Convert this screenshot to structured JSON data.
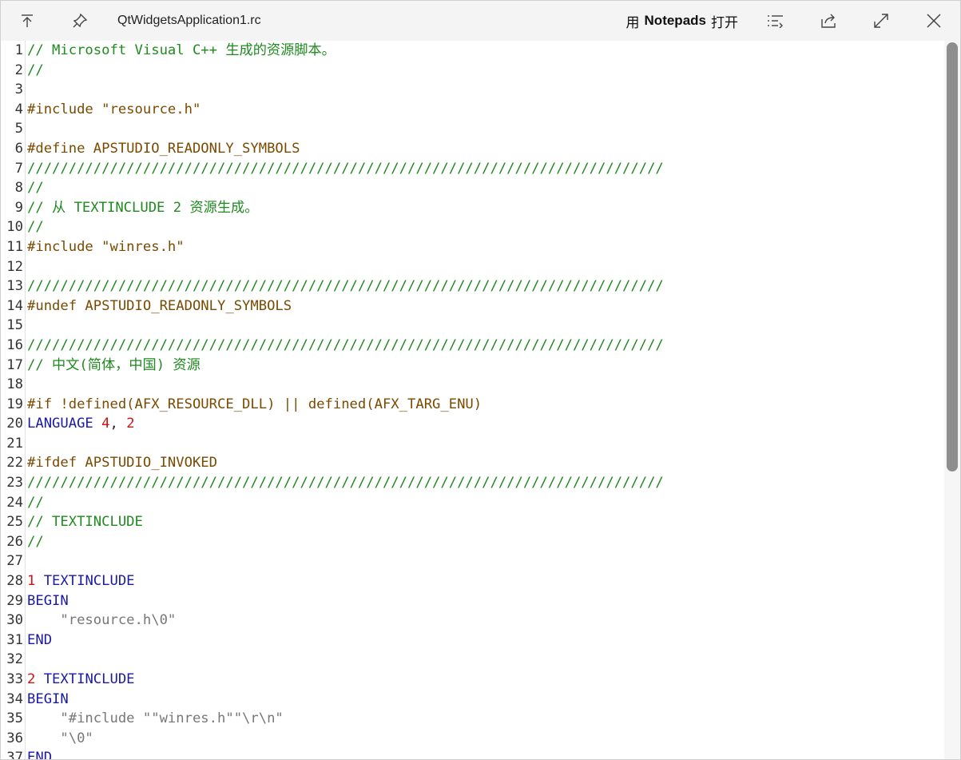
{
  "window": {
    "title": "QtWidgetsApplication1.rc",
    "open_with_prefix": "用",
    "open_with_app": "Notepads",
    "open_with_suffix": "打开"
  },
  "icons": {
    "pin_top": "arrow-to-top-icon",
    "pin": "pushpin-icon",
    "list": "list-icon",
    "share": "share-icon",
    "expand": "expand-diagonal-icon",
    "close": "close-icon"
  },
  "colors": {
    "comment": "#1f8a1f",
    "preprocessor": "#7a4a00",
    "keyword": "#1a1aa6",
    "number": "#d51010",
    "string": "#777777"
  },
  "scroll": {
    "thumb_fraction": 0.6
  },
  "lines": [
    {
      "n": "1",
      "segs": [
        {
          "t": "// Microsoft Visual C++ 生成的资源脚本。",
          "c": "comment"
        }
      ]
    },
    {
      "n": "2",
      "segs": [
        {
          "t": "//",
          "c": "comment"
        }
      ]
    },
    {
      "n": "3",
      "segs": []
    },
    {
      "n": "4",
      "segs": [
        {
          "t": "#include \"resource.h\"",
          "c": "pp"
        }
      ]
    },
    {
      "n": "5",
      "segs": []
    },
    {
      "n": "6",
      "segs": [
        {
          "t": "#define APSTUDIO_READONLY_SYMBOLS",
          "c": "pp"
        }
      ]
    },
    {
      "n": "7",
      "segs": [
        {
          "t": "/////////////////////////////////////////////////////////////////////////////",
          "c": "comment"
        }
      ]
    },
    {
      "n": "8",
      "segs": [
        {
          "t": "//",
          "c": "comment"
        }
      ]
    },
    {
      "n": "9",
      "segs": [
        {
          "t": "// 从 TEXTINCLUDE 2 资源生成。",
          "c": "comment"
        }
      ]
    },
    {
      "n": "10",
      "segs": [
        {
          "t": "//",
          "c": "comment"
        }
      ]
    },
    {
      "n": "11",
      "segs": [
        {
          "t": "#include \"winres.h\"",
          "c": "pp"
        }
      ]
    },
    {
      "n": "12",
      "segs": []
    },
    {
      "n": "13",
      "segs": [
        {
          "t": "/////////////////////////////////////////////////////////////////////////////",
          "c": "comment"
        }
      ]
    },
    {
      "n": "14",
      "segs": [
        {
          "t": "#undef APSTUDIO_READONLY_SYMBOLS",
          "c": "pp"
        }
      ]
    },
    {
      "n": "15",
      "segs": []
    },
    {
      "n": "16",
      "segs": [
        {
          "t": "/////////////////////////////////////////////////////////////////////////////",
          "c": "comment"
        }
      ]
    },
    {
      "n": "17",
      "segs": [
        {
          "t": "// 中文(简体，中国) 资源",
          "c": "comment"
        }
      ]
    },
    {
      "n": "18",
      "segs": []
    },
    {
      "n": "19",
      "segs": [
        {
          "t": "#if !defined(AFX_RESOURCE_DLL) || defined(AFX_TARG_ENU)",
          "c": "pp"
        }
      ]
    },
    {
      "n": "20",
      "segs": [
        {
          "t": "LANGUAGE ",
          "c": "kw"
        },
        {
          "t": "4",
          "c": "num"
        },
        {
          "t": ", ",
          "c": "plain"
        },
        {
          "t": "2",
          "c": "num"
        }
      ]
    },
    {
      "n": "21",
      "segs": []
    },
    {
      "n": "22",
      "segs": [
        {
          "t": "#ifdef APSTUDIO_INVOKED",
          "c": "pp"
        }
      ]
    },
    {
      "n": "23",
      "segs": [
        {
          "t": "/////////////////////////////////////////////////////////////////////////////",
          "c": "comment"
        }
      ]
    },
    {
      "n": "24",
      "segs": [
        {
          "t": "//",
          "c": "comment"
        }
      ]
    },
    {
      "n": "25",
      "segs": [
        {
          "t": "// TEXTINCLUDE",
          "c": "comment"
        }
      ]
    },
    {
      "n": "26",
      "segs": [
        {
          "t": "//",
          "c": "comment"
        }
      ]
    },
    {
      "n": "27",
      "segs": []
    },
    {
      "n": "28",
      "segs": [
        {
          "t": "1",
          "c": "num"
        },
        {
          "t": " TEXTINCLUDE",
          "c": "kw"
        }
      ]
    },
    {
      "n": "29",
      "segs": [
        {
          "t": "BEGIN",
          "c": "kw"
        }
      ]
    },
    {
      "n": "30",
      "segs": [
        {
          "t": "    \"resource.h\\0\"",
          "c": "str"
        }
      ]
    },
    {
      "n": "31",
      "segs": [
        {
          "t": "END",
          "c": "kw"
        }
      ]
    },
    {
      "n": "32",
      "segs": []
    },
    {
      "n": "33",
      "segs": [
        {
          "t": "2",
          "c": "num"
        },
        {
          "t": " TEXTINCLUDE",
          "c": "kw"
        }
      ]
    },
    {
      "n": "34",
      "segs": [
        {
          "t": "BEGIN",
          "c": "kw"
        }
      ]
    },
    {
      "n": "35",
      "segs": [
        {
          "t": "    \"#include \"\"winres.h\"\"\\r\\n\"",
          "c": "str"
        }
      ]
    },
    {
      "n": "36",
      "segs": [
        {
          "t": "    \"\\0\"",
          "c": "str"
        }
      ]
    },
    {
      "n": "37",
      "segs": [
        {
          "t": "END",
          "c": "kw"
        }
      ]
    }
  ]
}
